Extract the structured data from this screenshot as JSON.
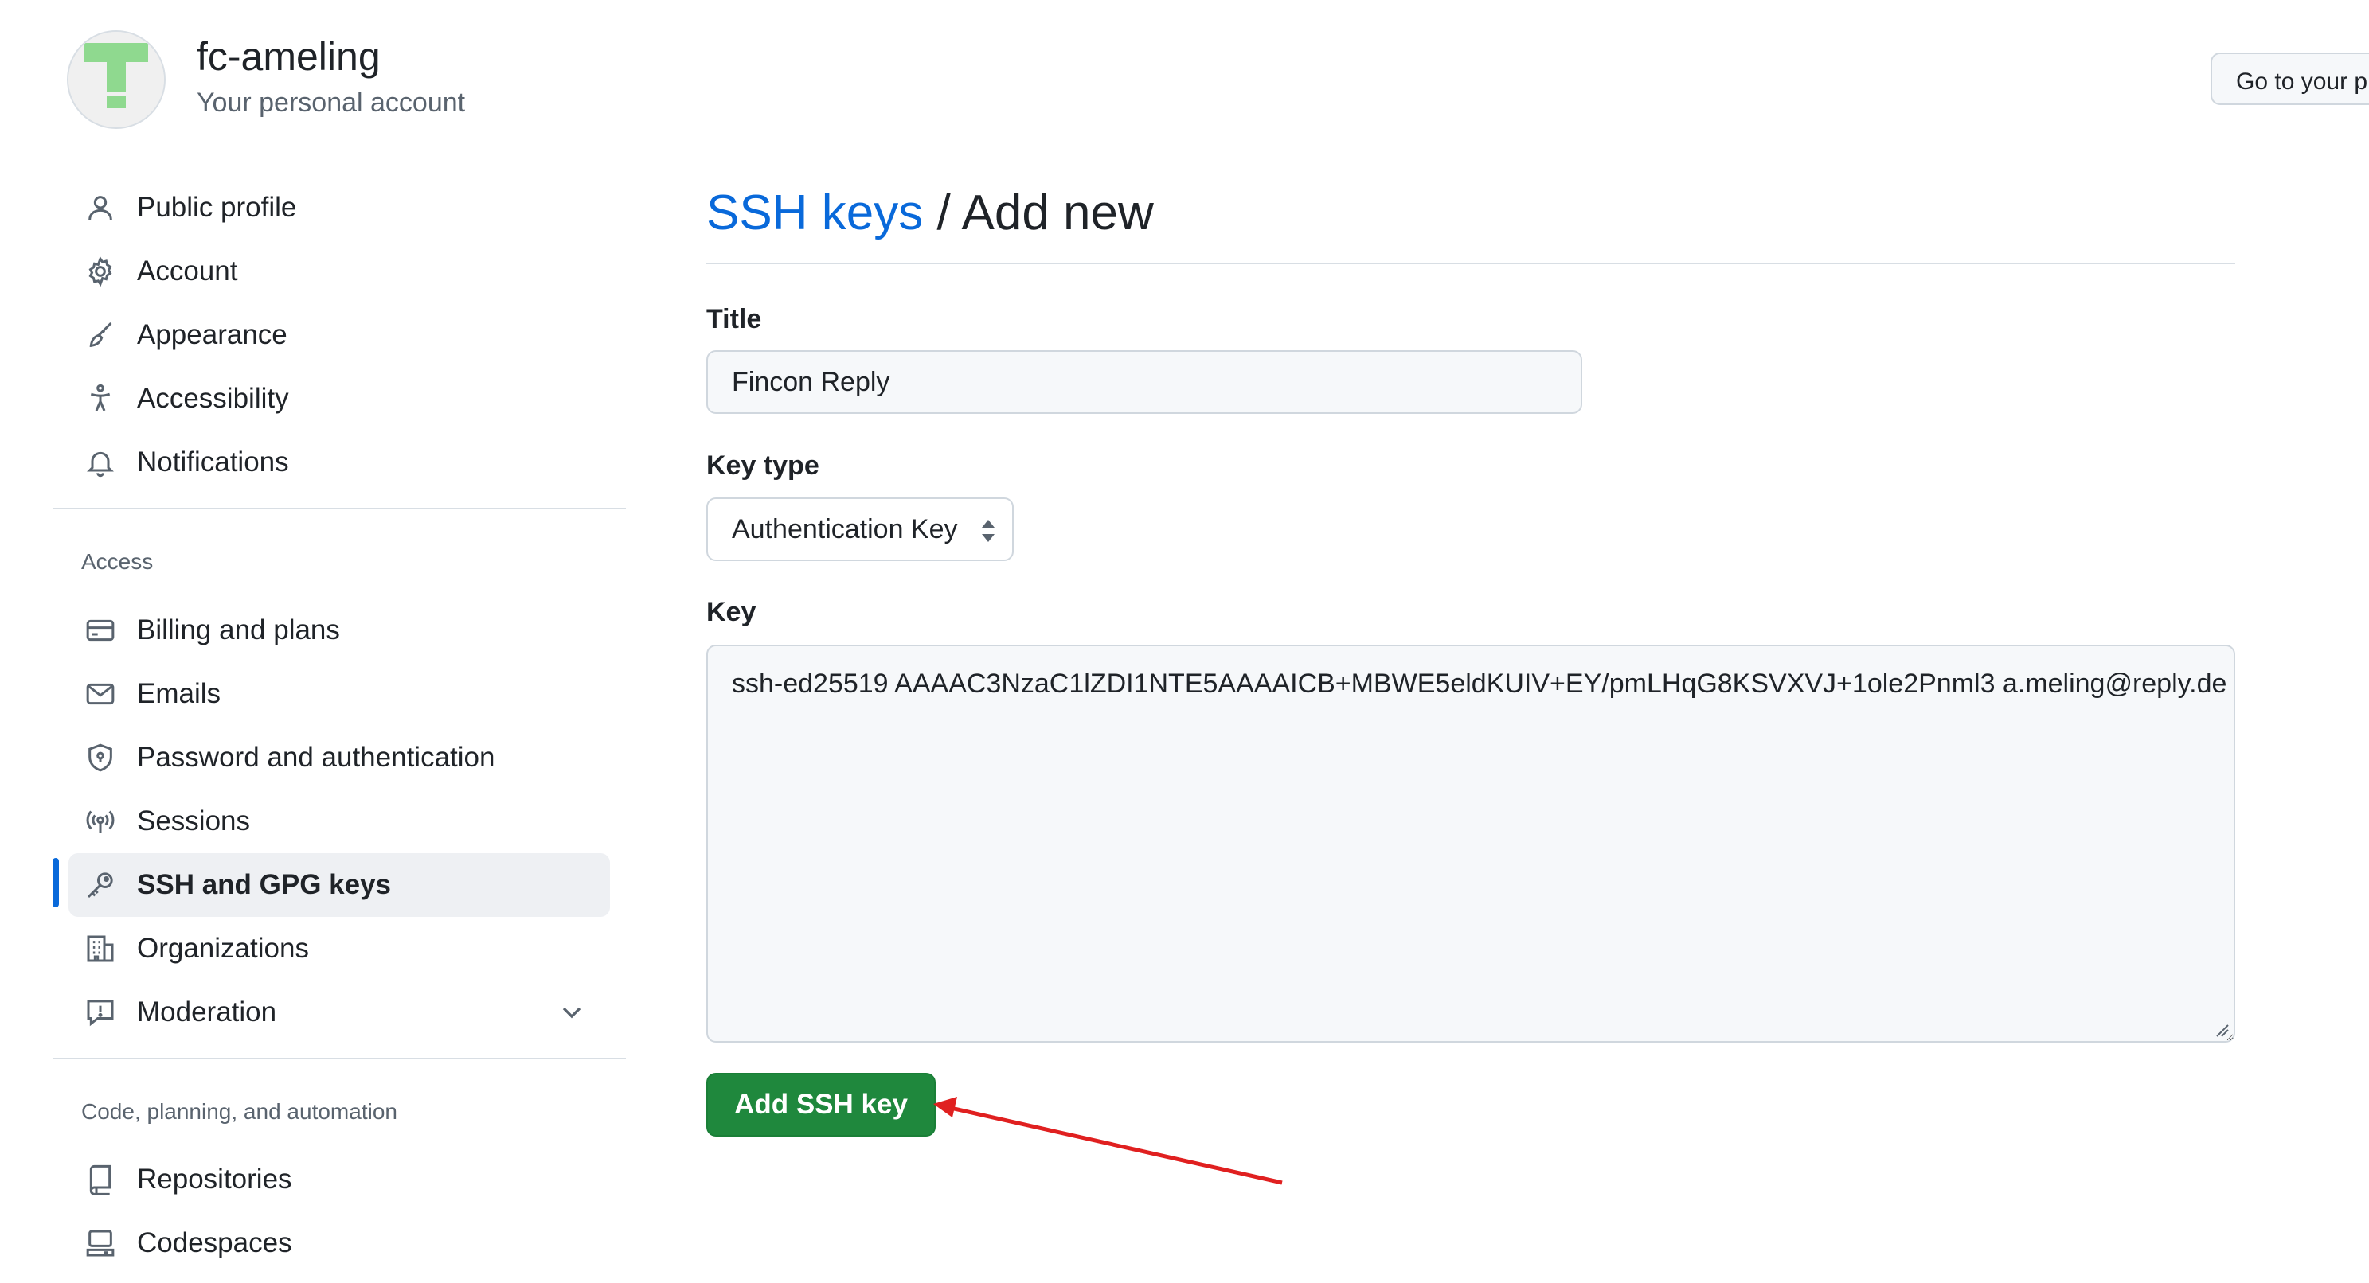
{
  "account": {
    "name": "fc-ameling",
    "subtitle": "Your personal account",
    "goto_button": "Go to your p"
  },
  "sidebar": {
    "top_items": [
      {
        "label": "Public profile",
        "icon": "person-icon"
      },
      {
        "label": "Account",
        "icon": "gear-icon"
      },
      {
        "label": "Appearance",
        "icon": "paintbrush-icon"
      },
      {
        "label": "Accessibility",
        "icon": "accessibility-icon"
      },
      {
        "label": "Notifications",
        "icon": "bell-icon"
      }
    ],
    "access_heading": "Access",
    "access_items": [
      {
        "label": "Billing and plans",
        "icon": "credit-card-icon"
      },
      {
        "label": "Emails",
        "icon": "mail-icon"
      },
      {
        "label": "Password and authentication",
        "icon": "shield-lock-icon"
      },
      {
        "label": "Sessions",
        "icon": "broadcast-icon"
      },
      {
        "label": "SSH and GPG keys",
        "icon": "key-icon",
        "active": true
      },
      {
        "label": "Organizations",
        "icon": "organization-icon"
      },
      {
        "label": "Moderation",
        "icon": "report-icon"
      }
    ],
    "code_heading": "Code, planning, and automation",
    "code_items": [
      {
        "label": "Repositories",
        "icon": "repo-icon"
      },
      {
        "label": "Codespaces",
        "icon": "codespaces-icon"
      }
    ]
  },
  "main": {
    "breadcrumb_link": "SSH keys",
    "breadcrumb_sep": "/",
    "breadcrumb_current": "Add new",
    "title_label": "Title",
    "title_value": "Fincon Reply",
    "key_type_label": "Key type",
    "key_type_value": "Authentication Key",
    "key_label": "Key",
    "key_value": "ssh-ed25519 AAAAC3NzaC1lZDI1NTE5AAAAICB+MBWE5eldKUIV+EY/pmLHqG8KSVXVJ+1ole2Pnml3 a.meling@reply.de",
    "submit_label": "Add SSH key"
  },
  "colors": {
    "link_blue": "#0969da",
    "primary_green": "#1f883d",
    "annotation_red": "#e02020"
  }
}
